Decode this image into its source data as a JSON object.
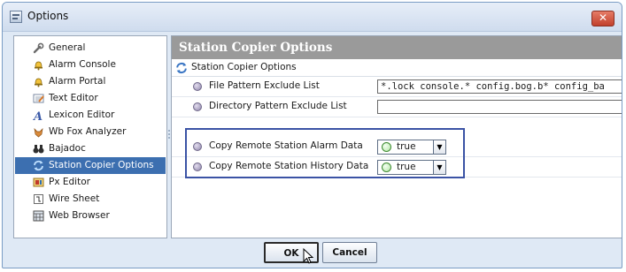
{
  "window": {
    "title": "Options",
    "close_label": "✕"
  },
  "sidebar": {
    "items": [
      {
        "label": "General",
        "icon": "wrench-icon"
      },
      {
        "label": "Alarm Console",
        "icon": "bell-icon"
      },
      {
        "label": "Alarm Portal",
        "icon": "bell-icon"
      },
      {
        "label": "Text Editor",
        "icon": "text-editor-icon"
      },
      {
        "label": "Lexicon Editor",
        "icon": "lexicon-a-icon"
      },
      {
        "label": "Wb Fox Analyzer",
        "icon": "fox-icon"
      },
      {
        "label": "Bajadoc",
        "icon": "binoculars-icon"
      },
      {
        "label": "Station Copier Options",
        "icon": "station-copier-icon",
        "selected": true
      },
      {
        "label": "Px Editor",
        "icon": "px-editor-icon"
      },
      {
        "label": "Wire Sheet",
        "icon": "wire-sheet-icon"
      },
      {
        "label": "Web Browser",
        "icon": "web-browser-icon"
      }
    ]
  },
  "main": {
    "header": "Station Copier Options",
    "root": {
      "label": "Station Copier Options",
      "icon": "station-copier-icon"
    },
    "properties": [
      {
        "label": "File Pattern Exclude List",
        "type": "text",
        "value": "*.lock console.* config.bog.b* config_ba"
      },
      {
        "label": "Directory Pattern Exclude List",
        "type": "text",
        "value": ""
      },
      {
        "label": "Copy Remote Station Alarm Data",
        "type": "bool",
        "value": "true"
      },
      {
        "label": "Copy Remote Station History Data",
        "type": "bool",
        "value": "true"
      }
    ]
  },
  "footer": {
    "ok_label": "OK",
    "cancel_label": "Cancel"
  },
  "colors": {
    "selection": "#3c6fb0",
    "highlight": "#3b53a5",
    "header": "#9a9a9a",
    "close": "#c2402c"
  }
}
